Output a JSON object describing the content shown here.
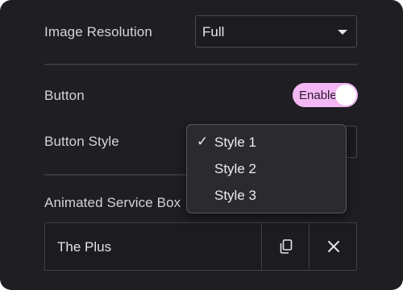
{
  "image_resolution": {
    "label": "Image Resolution",
    "value": "Full"
  },
  "button": {
    "label": "Button",
    "toggle_text": "Enable",
    "enabled": true
  },
  "button_style": {
    "label": "Button Style",
    "selected": "Style 1",
    "options": [
      "Style 1",
      "Style 2",
      "Style 3"
    ],
    "check_mark": "✓"
  },
  "animated_service_box": {
    "label": "Animated Service Box",
    "item_title": "The Plus",
    "duplicate_icon": "copy-icon",
    "remove_icon": "close-icon"
  },
  "colors": {
    "panel_bg": "#1f1f23",
    "toggle_on": "#f3b8f3"
  }
}
